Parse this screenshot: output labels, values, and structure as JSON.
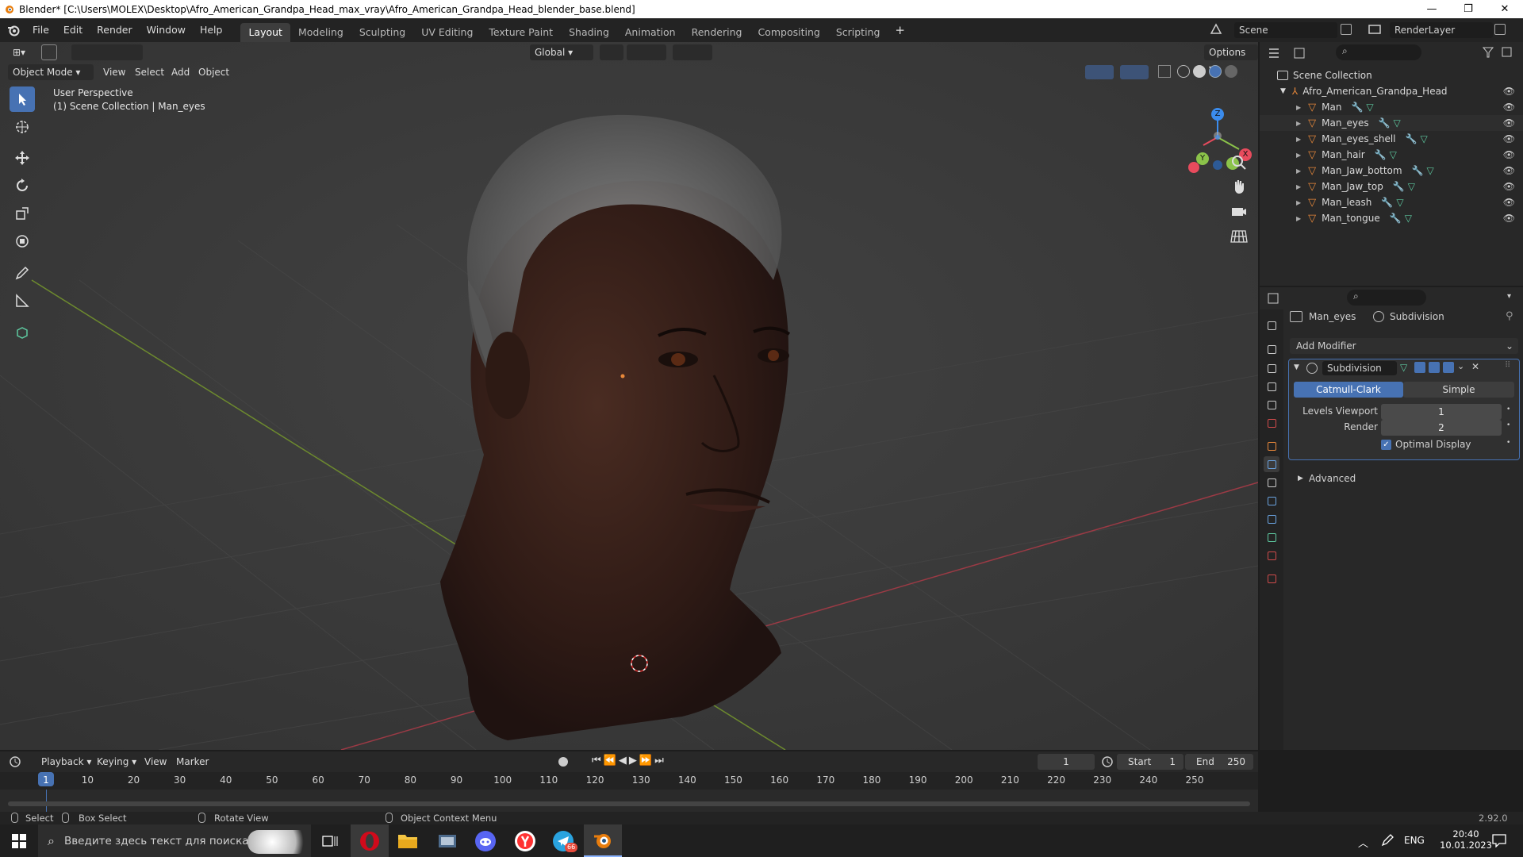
{
  "window": {
    "title": "Blender* [C:\\Users\\MOLEX\\Desktop\\Afro_American_Grandpa_Head_max_vray\\Afro_American_Grandpa_Head_blender_base.blend]",
    "minimize": "—",
    "restore": "❐",
    "close": "✕"
  },
  "menubar": {
    "menus": [
      "File",
      "Edit",
      "Render",
      "Window",
      "Help"
    ],
    "workspaces": [
      "Layout",
      "Modeling",
      "Sculpting",
      "UV Editing",
      "Texture Paint",
      "Shading",
      "Animation",
      "Rendering",
      "Compositing",
      "Scripting"
    ],
    "active_workspace": "Layout",
    "add_workspace": "+",
    "scene_label": "Scene",
    "render_layer_label": "RenderLayer"
  },
  "viewport": {
    "mode": "Object Mode",
    "menus": [
      "View",
      "Select",
      "Add",
      "Object"
    ],
    "transform_orientation": "Global",
    "options_label": "Options",
    "overlay_line1": "User Perspective",
    "overlay_line2": "(1) Scene Collection | Man_eyes",
    "gizmo": {
      "z": "Z",
      "y": "Y",
      "x": "X"
    }
  },
  "outliner": {
    "root": "Scene Collection",
    "collection": "Afro_American_Grandpa_Head",
    "objects": [
      "Man",
      "Man_eyes",
      "Man_eyes_shell",
      "Man_hair",
      "Man_Jaw_bottom",
      "Man_Jaw_top",
      "Man_leash",
      "Man_tongue"
    ]
  },
  "properties": {
    "object_name": "Man_eyes",
    "modifier_tab": "Subdivision",
    "add_modifier": "Add Modifier",
    "modifier_name": "Subdivision",
    "method_catmull": "Catmull-Clark",
    "method_simple": "Simple",
    "levels_viewport_label": "Levels Viewport",
    "levels_viewport_value": "1",
    "render_label": "Render",
    "render_value": "2",
    "optimal_display_label": "Optimal Display",
    "advanced_label": "Advanced"
  },
  "timeline": {
    "menus": [
      "Playback",
      "Keying",
      "View",
      "Marker"
    ],
    "current_frame": "1",
    "start_label": "Start",
    "start_value": "1",
    "end_label": "End",
    "end_value": "250",
    "ticks": [
      "1",
      "10",
      "20",
      "30",
      "40",
      "50",
      "60",
      "70",
      "80",
      "90",
      "100",
      "110",
      "120",
      "130",
      "140",
      "150",
      "160",
      "170",
      "180",
      "190",
      "200",
      "210",
      "220",
      "230",
      "240",
      "250"
    ]
  },
  "statusbar": {
    "select": "Select",
    "box_select": "Box Select",
    "rotate_view": "Rotate View",
    "context_menu": "Object Context Menu",
    "version": "2.92.0"
  },
  "taskbar": {
    "search_placeholder": "Введите здесь текст для поиска",
    "lang": "ENG",
    "time": "20:40",
    "date": "10.01.2023",
    "telegram_badge": "66"
  },
  "colors": {
    "accent": "#4772b3",
    "object_orange": "#e8883a",
    "mesh_green": "#5ec9a0",
    "axis_x": "#e84b5d",
    "axis_y": "#8bc34a",
    "axis_z": "#3b8ced"
  }
}
